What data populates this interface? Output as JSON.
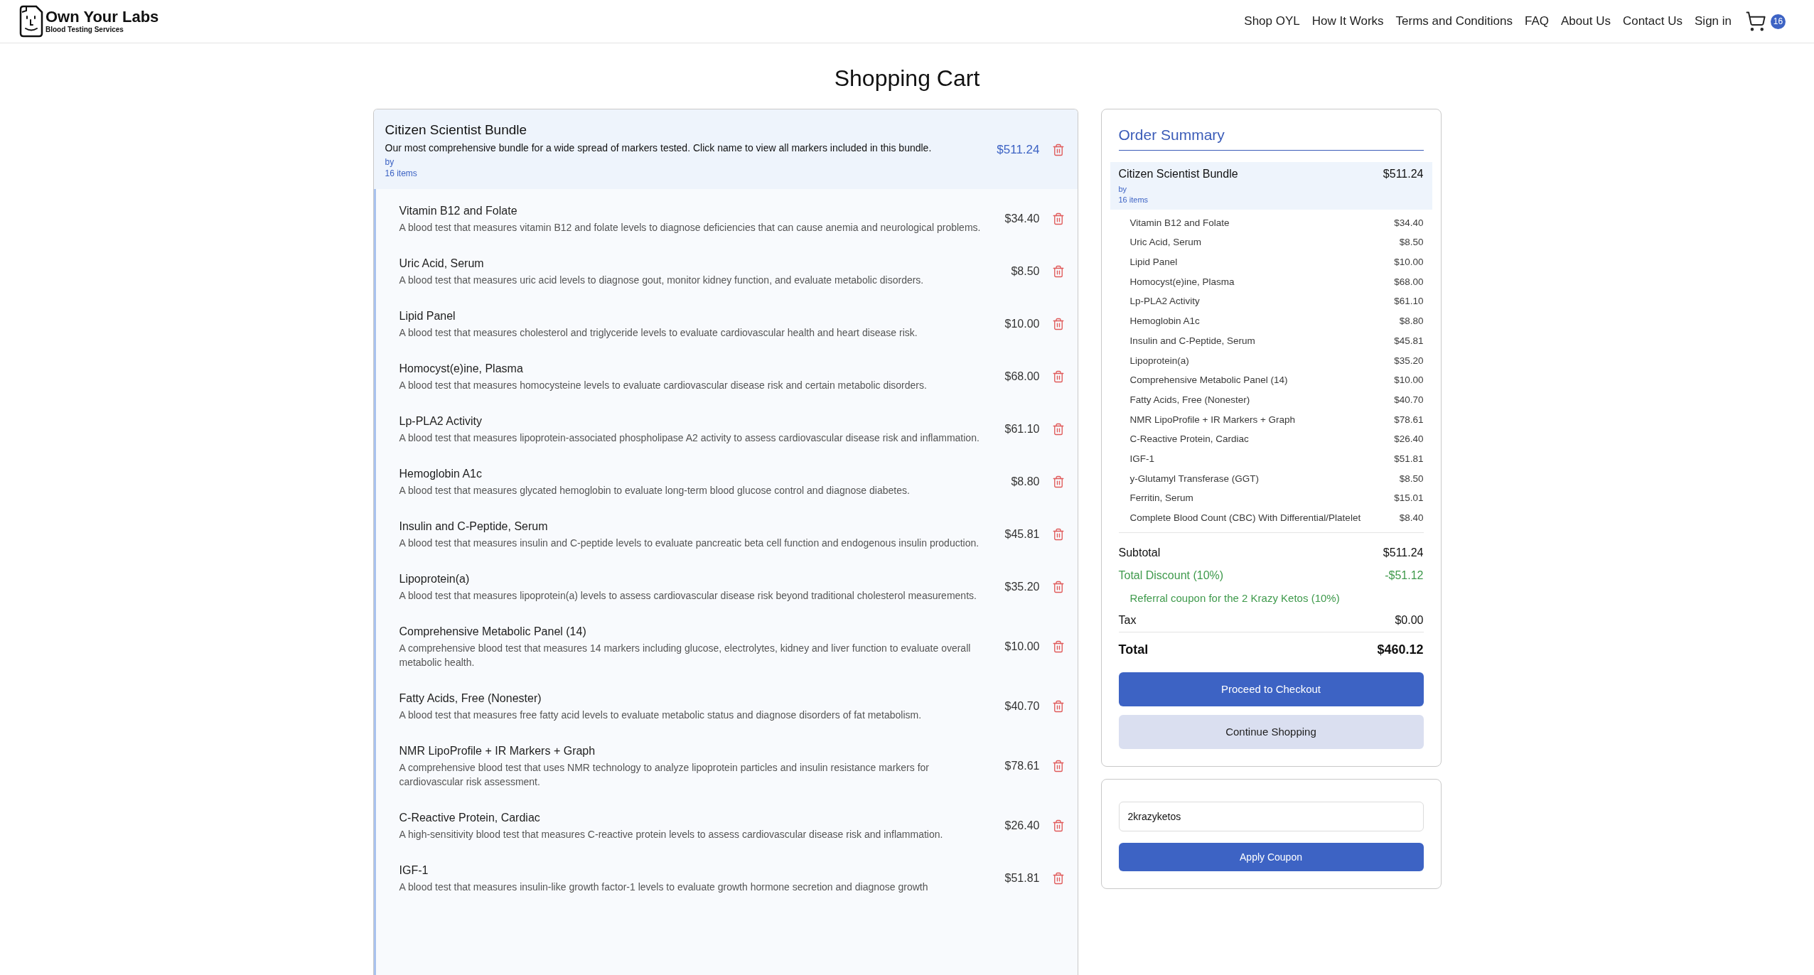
{
  "header": {
    "logo": {
      "title": "Own Your Labs",
      "subtitle": "Blood Testing Services"
    },
    "nav": [
      "Shop OYL",
      "How It Works",
      "Terms and Conditions",
      "FAQ",
      "About Us",
      "Contact Us",
      "Sign in"
    ],
    "cart_count": "16"
  },
  "page_title": "Shopping Cart",
  "cart": {
    "bundle": {
      "name": "Citizen Scientist Bundle",
      "description": "Our most comprehensive bundle for a wide spread of markers tested. Click name to view all markers included in this bundle.",
      "by": "by",
      "count": "16 items",
      "price": "$511.24"
    },
    "items": [
      {
        "name": "Vitamin B12 and Folate",
        "description": "A blood test that measures vitamin B12 and folate levels to diagnose deficiencies that can cause anemia and neurological problems.",
        "price": "$34.40"
      },
      {
        "name": "Uric Acid, Serum",
        "description": "A blood test that measures uric acid levels to diagnose gout, monitor kidney function, and evaluate metabolic disorders.",
        "price": "$8.50"
      },
      {
        "name": "Lipid Panel",
        "description": "A blood test that measures cholesterol and triglyceride levels to evaluate cardiovascular health and heart disease risk.",
        "price": "$10.00"
      },
      {
        "name": "Homocyst(e)ine, Plasma",
        "description": "A blood test that measures homocysteine levels to evaluate cardiovascular disease risk and certain metabolic disorders.",
        "price": "$68.00"
      },
      {
        "name": "Lp-PLA2 Activity",
        "description": "A blood test that measures lipoprotein-associated phospholipase A2 activity to assess cardiovascular disease risk and inflammation.",
        "price": "$61.10"
      },
      {
        "name": "Hemoglobin A1c",
        "description": "A blood test that measures glycated hemoglobin to evaluate long-term blood glucose control and diagnose diabetes.",
        "price": "$8.80"
      },
      {
        "name": "Insulin and C-Peptide, Serum",
        "description": "A blood test that measures insulin and C-peptide levels to evaluate pancreatic beta cell function and endogenous insulin production.",
        "price": "$45.81"
      },
      {
        "name": "Lipoprotein(a)",
        "description": "A blood test that measures lipoprotein(a) levels to assess cardiovascular disease risk beyond traditional cholesterol measurements.",
        "price": "$35.20"
      },
      {
        "name": "Comprehensive Metabolic Panel (14)",
        "description": "A comprehensive blood test that measures 14 markers including glucose, electrolytes, kidney and liver function to evaluate overall metabolic health.",
        "price": "$10.00"
      },
      {
        "name": "Fatty Acids, Free (Nonester)",
        "description": "A blood test that measures free fatty acid levels to evaluate metabolic status and diagnose disorders of fat metabolism.",
        "price": "$40.70"
      },
      {
        "name": "NMR LipoProfile + IR Markers + Graph",
        "description": "A comprehensive blood test that uses NMR technology to analyze lipoprotein particles and insulin resistance markers for cardiovascular risk assessment.",
        "price": "$78.61"
      },
      {
        "name": "C-Reactive Protein, Cardiac",
        "description": "A high-sensitivity blood test that measures C-reactive protein levels to assess cardiovascular disease risk and inflammation.",
        "price": "$26.40"
      },
      {
        "name": "IGF-1",
        "description": "A blood test that measures insulin-like growth factor-1 levels to evaluate growth hormone secretion and diagnose growth",
        "price": "$51.81"
      }
    ]
  },
  "order_summary": {
    "title": "Order Summary",
    "bundle": {
      "name": "Citizen Scientist Bundle",
      "by": "by",
      "count": "16 items",
      "price": "$511.24"
    },
    "items": [
      {
        "name": "Vitamin B12 and Folate",
        "price": "$34.40"
      },
      {
        "name": "Uric Acid, Serum",
        "price": "$8.50"
      },
      {
        "name": "Lipid Panel",
        "price": "$10.00"
      },
      {
        "name": "Homocyst(e)ine, Plasma",
        "price": "$68.00"
      },
      {
        "name": "Lp-PLA2 Activity",
        "price": "$61.10"
      },
      {
        "name": "Hemoglobin A1c",
        "price": "$8.80"
      },
      {
        "name": "Insulin and C-Peptide, Serum",
        "price": "$45.81"
      },
      {
        "name": "Lipoprotein(a)",
        "price": "$35.20"
      },
      {
        "name": "Comprehensive Metabolic Panel (14)",
        "price": "$10.00"
      },
      {
        "name": "Fatty Acids, Free (Nonester)",
        "price": "$40.70"
      },
      {
        "name": "NMR LipoProfile + IR Markers + Graph",
        "price": "$78.61"
      },
      {
        "name": "C-Reactive Protein, Cardiac",
        "price": "$26.40"
      },
      {
        "name": "IGF-1",
        "price": "$51.81"
      },
      {
        "name": "y-Glutamyl Transferase (GGT)",
        "price": "$8.50"
      },
      {
        "name": "Ferritin, Serum",
        "price": "$15.01"
      },
      {
        "name": "Complete Blood Count (CBC) With Differential/Platelet",
        "price": "$8.40"
      }
    ],
    "subtotal": {
      "label": "Subtotal",
      "value": "$511.24"
    },
    "discount": {
      "label": "Total Discount (10%)",
      "value": "-$51.12"
    },
    "coupon_note": "Referral coupon for the 2 Krazy Ketos (10%)",
    "tax": {
      "label": "Tax",
      "value": "$0.00"
    },
    "total": {
      "label": "Total",
      "value": "$460.12"
    },
    "buttons": [
      {
        "label": "Proceed to Checkout",
        "kind": "primary"
      },
      {
        "label": "Continue Shopping",
        "kind": "secondary"
      }
    ]
  },
  "coupon": {
    "value": "2krazyketos",
    "button": "Apply Coupon"
  }
}
